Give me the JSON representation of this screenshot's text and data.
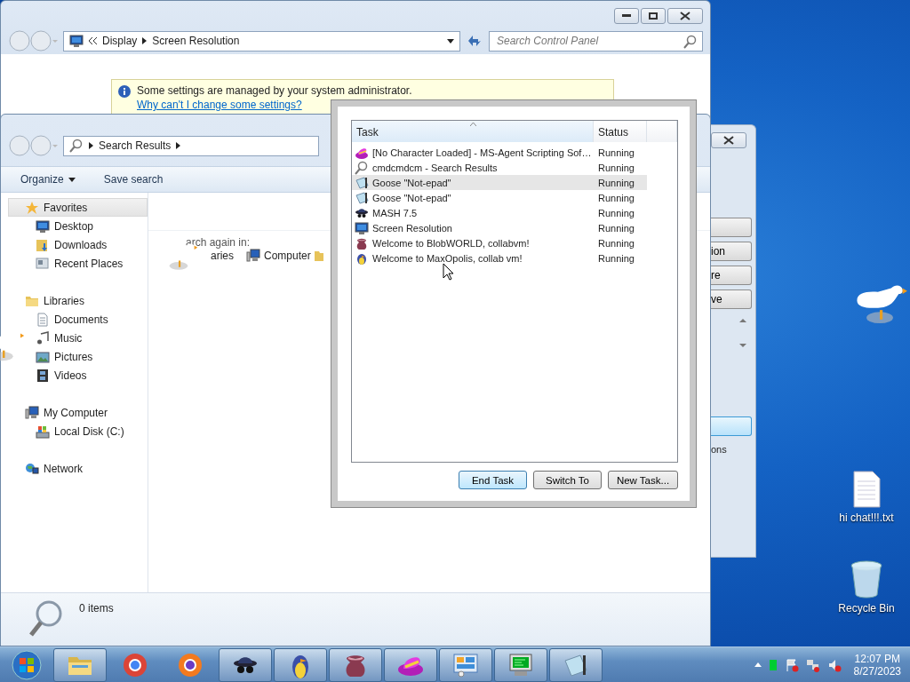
{
  "control_panel": {
    "breadcrumbs": [
      "Display",
      "Screen Resolution"
    ],
    "search": {
      "placeholder": "Search Control Panel"
    },
    "info": {
      "message": "Some settings are managed by your system administrator.",
      "link": "Why can't I change some settings?"
    }
  },
  "explorer": {
    "breadcrumbs": [
      "Search Results"
    ],
    "toolbar": [
      "Organize",
      "Save search"
    ],
    "nav": [
      {
        "label": "Favorites",
        "selected": true,
        "children": [
          {
            "label": "Desktop",
            "selected": false
          },
          {
            "label": "Downloads",
            "selected": false
          },
          {
            "label": "Recent Places",
            "selected": false
          }
        ]
      },
      {
        "label": "Libraries",
        "selected": false,
        "children": [
          {
            "label": "Documents",
            "selected": false
          },
          {
            "label": "Music",
            "selected": false
          },
          {
            "label": "Pictures",
            "selected": false
          },
          {
            "label": "Videos",
            "selected": false
          }
        ]
      },
      {
        "label": "My Computer",
        "selected": false,
        "children": [
          {
            "label": "Local Disk (C:)",
            "selected": false
          }
        ]
      },
      {
        "label": "Network",
        "selected": false
      }
    ],
    "search_again": {
      "label": "arch again in:",
      "locations": [
        "aries",
        "Computer"
      ]
    },
    "status": "0 items"
  },
  "task_manager": {
    "columns": [
      "Task",
      "Status"
    ],
    "rows": [
      {
        "task": "[No Character Loaded] - MS-Agent Scripting Sof…",
        "status": "Running",
        "selected": false
      },
      {
        "task": "cmdcmdcm - Search Results",
        "status": "Running",
        "selected": false
      },
      {
        "task": "Goose \"Not-epad\"",
        "status": "Running",
        "selected": true
      },
      {
        "task": "Goose \"Not-epad\"",
        "status": "Running",
        "selected": false
      },
      {
        "task": "MASH 7.5",
        "status": "Running",
        "selected": false
      },
      {
        "task": "Screen Resolution",
        "status": "Running",
        "selected": false
      },
      {
        "task": "Welcome to BlobWORLD, collabvm!",
        "status": "Running",
        "selected": false
      },
      {
        "task": "Welcome to MaxOpolis, collab vm!",
        "status": "Running",
        "selected": false
      }
    ],
    "buttons": [
      {
        "label": "End Task",
        "focused": true
      },
      {
        "label": "Switch To",
        "focused": false
      },
      {
        "label": "New Task...",
        "focused": false
      }
    ]
  },
  "side_window": {
    "buttons": [
      "ion",
      "re",
      "ve"
    ],
    "option": "ons"
  },
  "desktop_icons": [
    {
      "label": "hi chat!!!.txt"
    },
    {
      "label": "Recycle Bin"
    }
  ],
  "taskbar": {
    "apps": [
      {
        "running": true
      },
      {
        "running": false
      },
      {
        "running": false
      },
      {
        "running": true
      },
      {
        "running": true
      },
      {
        "running": true
      },
      {
        "running": true
      },
      {
        "running": true
      },
      {
        "running": true
      },
      {
        "running": true
      }
    ],
    "clock": {
      "time": "12:07 PM",
      "date": "8/27/2023"
    }
  }
}
